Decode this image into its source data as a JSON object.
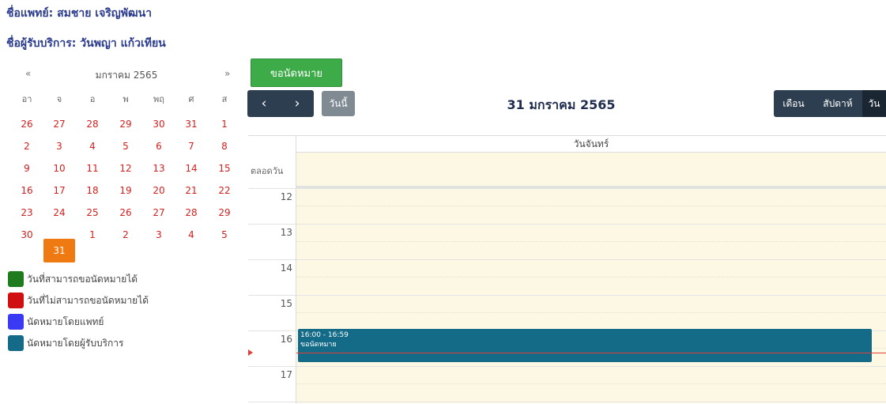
{
  "header": {
    "doctor": "ชื่อแพทย์: สมชาย เจริญพัฒนา",
    "patient": "ชื่อผู้รับบริการ: วันพญา แก้วเทียน"
  },
  "mini_calendar": {
    "prev": "«",
    "next": "»",
    "title": "มกราคม 2565",
    "weekdays": [
      "อา",
      "จ",
      "อ",
      "พ",
      "พฤ",
      "ศ",
      "ส"
    ],
    "weeks": [
      [
        "26",
        "27",
        "28",
        "29",
        "30",
        "31",
        "1"
      ],
      [
        "2",
        "3",
        "4",
        "5",
        "6",
        "7",
        "8"
      ],
      [
        "9",
        "10",
        "11",
        "12",
        "13",
        "14",
        "15"
      ],
      [
        "16",
        "17",
        "18",
        "19",
        "20",
        "21",
        "22"
      ],
      [
        "23",
        "24",
        "25",
        "26",
        "27",
        "28",
        "29"
      ],
      [
        "30",
        "31",
        "1",
        "2",
        "3",
        "4",
        "5"
      ]
    ],
    "selected": "31"
  },
  "legend": [
    {
      "label": "วันที่สามารถขอนัดหมายได้",
      "color": "#1e7b1e"
    },
    {
      "label": "วันที่ไม่สามารถขอนัดหมายได้",
      "color": "#d01010"
    },
    {
      "label": "นัดหมายโดยแพทย์",
      "color": "#3a3af5"
    },
    {
      "label": "นัดหมายโดยผู้รับบริการ",
      "color": "#146b87"
    }
  ],
  "toolbar": {
    "book": "ขอนัดหมาย",
    "prev": "‹",
    "next": "›",
    "today": "วันนี้",
    "title": "31 มกราคม 2565",
    "views": [
      "เดือน",
      "สัปดาห์",
      "วัน"
    ],
    "active_view": "วัน"
  },
  "day_view": {
    "column": "วันจันทร์",
    "allday": "ตลอดวัน",
    "hours": [
      "12",
      "13",
      "14",
      "15",
      "16",
      "17"
    ],
    "event": {
      "time": "16:00 - 16:59",
      "title": "ขอนัดหมาย",
      "color": "#146b87"
    }
  }
}
